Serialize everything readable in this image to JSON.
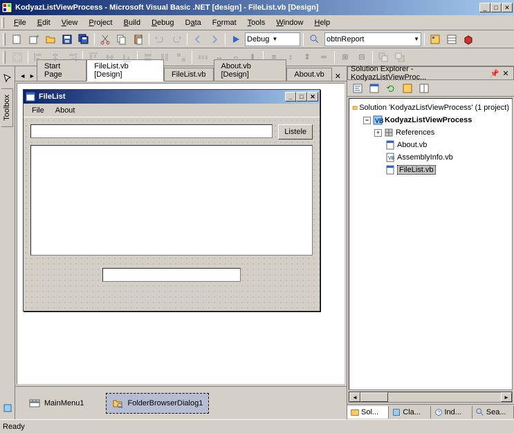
{
  "window": {
    "title": "KodyazListViewProcess - Microsoft Visual Basic .NET [design] - FileList.vb [Design]"
  },
  "menu": {
    "items": [
      "File",
      "Edit",
      "View",
      "Project",
      "Build",
      "Debug",
      "Data",
      "Format",
      "Tools",
      "Window",
      "Help"
    ]
  },
  "toolbar": {
    "config": "Debug",
    "target": "obtnReport"
  },
  "tabs": {
    "items": [
      "Start Page",
      "FileList.vb [Design]",
      "FileList.vb",
      "About.vb [Design]",
      "About.vb"
    ],
    "active_index": 1
  },
  "vtab": {
    "label": "Toolbox"
  },
  "form": {
    "title": "FileList",
    "menu": [
      "File",
      "About"
    ],
    "button_label": "Listele"
  },
  "tray": {
    "items": [
      "MainMenu1",
      "FolderBrowserDialog1"
    ],
    "selected_index": 1
  },
  "solution": {
    "title": "Solution Explorer - KodyazListViewProc...",
    "root": "Solution 'KodyazListViewProcess' (1 project)",
    "project": "KodyazListViewProcess",
    "references": "References",
    "files": [
      "About.vb",
      "AssemblyInfo.vb",
      "FileList.vb"
    ],
    "selected_file_index": 2,
    "tabs": [
      "Sol...",
      "Cla...",
      "Ind...",
      "Sea..."
    ]
  },
  "status": {
    "text": "Ready"
  }
}
